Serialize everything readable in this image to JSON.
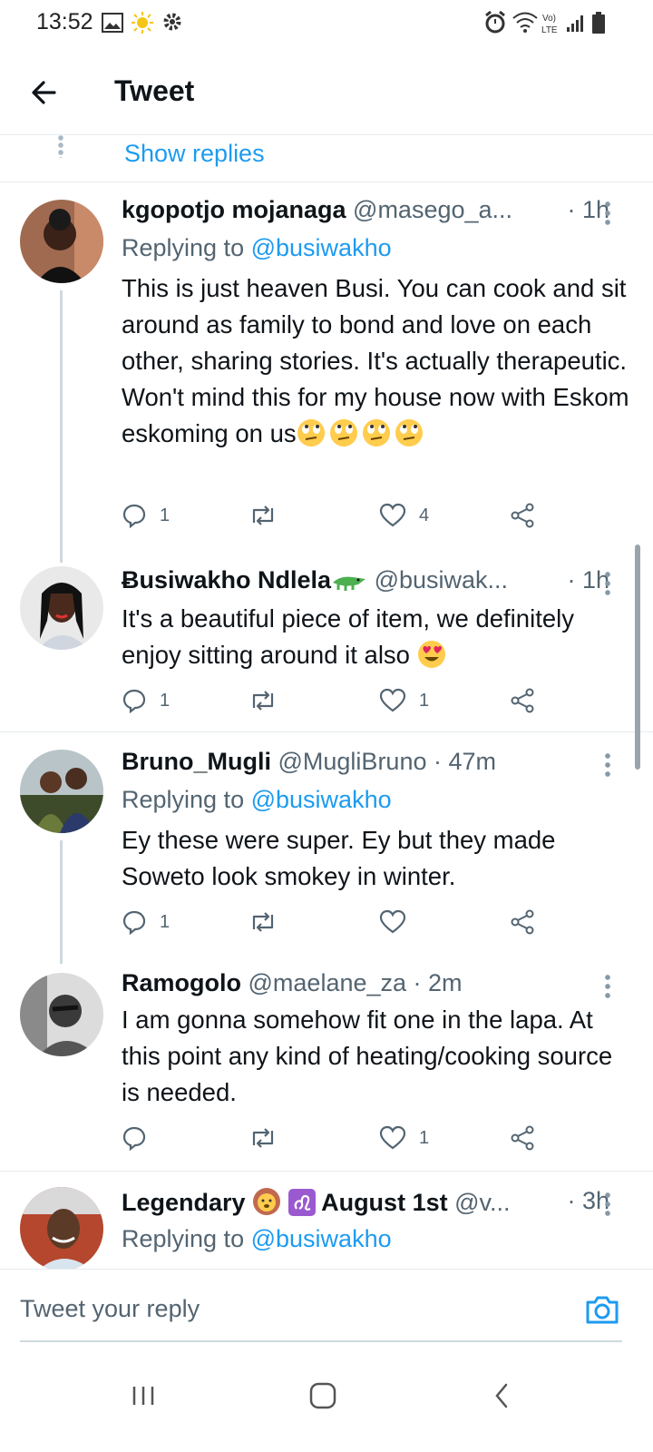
{
  "status_bar": {
    "time": "13:52"
  },
  "header": {
    "title": "Tweet"
  },
  "show_replies": "Show replies",
  "tweets": [
    {
      "name": "kgopotjo mojanaga",
      "handle": "@masego_a...",
      "time": "· 1h",
      "replying_label": "Replying to",
      "replying_handle": "@busiwakho",
      "text": "This is just heaven Busi. You can cook and sit around as family to bond and love on each other, sharing stories. It's actually therapeutic. Won't mind this for my house now with Eskom eskoming on us",
      "counts": {
        "reply": "1",
        "retweet": "",
        "like": "4"
      }
    },
    {
      "name": "Ƀusiwakho Ndlela",
      "handle": "@busiwak...",
      "time": "· 1h",
      "text": "It's a beautiful piece of item, we definitely enjoy sitting around it also",
      "counts": {
        "reply": "1",
        "retweet": "",
        "like": "1"
      }
    },
    {
      "name": "Bruno_Mugli",
      "handle": "@MugliBruno · 47m",
      "replying_label": "Replying to",
      "replying_handle": "@busiwakho",
      "text": "Ey these were super. Ey but they made Soweto look smokey in winter.",
      "counts": {
        "reply": "1",
        "retweet": "",
        "like": ""
      }
    },
    {
      "name": "Ramogolo",
      "handle": "@maelane_za · 2m",
      "text": "I am gonna somehow fit one in the lapa. At this point any kind of heating/cooking source is needed.",
      "counts": {
        "reply": "",
        "retweet": "",
        "like": "1"
      }
    },
    {
      "name": "Legendary",
      "name_suffix": "August 1st",
      "handle": "@v...",
      "time": "· 3h",
      "replying_label": "Replying to",
      "replying_handle": "@busiwakho"
    }
  ],
  "reply_bar": {
    "placeholder": "Tweet your reply"
  },
  "colors": {
    "accent": "#1d9bf0",
    "secondary_text": "#536471",
    "border": "#e6ecf0"
  }
}
